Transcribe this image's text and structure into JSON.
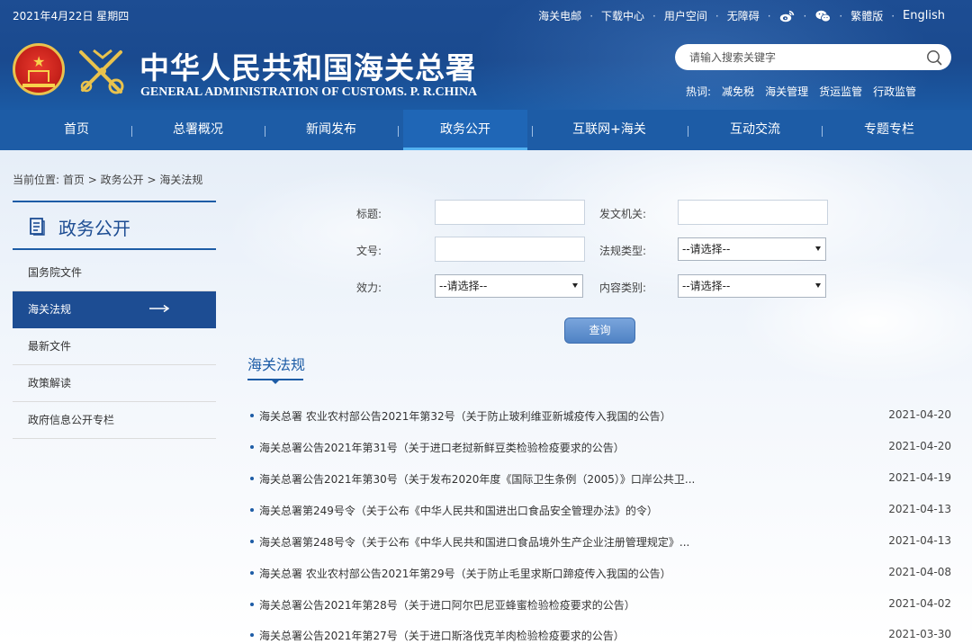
{
  "header": {
    "date": "2021年4月22日 星期四",
    "top_links": [
      "海关电邮",
      "下载中心",
      "用户空间",
      "无障碍"
    ],
    "icons": [
      "weibo-icon",
      "wechat-icon"
    ],
    "lang_links": [
      "繁體版",
      "English"
    ],
    "title_cn": "中华人民共和国海关总署",
    "title_en": "GENERAL ADMINISTRATION OF CUSTOMS. P. R.CHINA",
    "search_placeholder": "请输入搜索关键字",
    "hot_label": "热词:",
    "hot_words": [
      "减免税",
      "海关管理",
      "货运监管",
      "行政监管"
    ]
  },
  "nav": [
    "首页",
    "总署概况",
    "新闻发布",
    "政务公开",
    "互联网+海关",
    "互动交流",
    "专题专栏"
  ],
  "nav_active": "政务公开",
  "breadcrumb": {
    "prefix": "当前位置:",
    "items": [
      "首页",
      "政务公开",
      "海关法规"
    ],
    "separator": ">"
  },
  "sidebar": {
    "title": "政务公开",
    "items": [
      "国务院文件",
      "海关法规",
      "最新文件",
      "政策解读",
      "政府信息公开专栏"
    ],
    "active": "海关法规"
  },
  "form": {
    "title_label": "标题:",
    "issuer_label": "发文机关:",
    "docno_label": "文号:",
    "type_label": "法规类型:",
    "type_value": "--请选择--",
    "effect_label": "效力:",
    "effect_value": "--请选择--",
    "category_label": "内容类别:",
    "category_value": "--请选择--",
    "query_button": "查询"
  },
  "section_title": "海关法规",
  "news": [
    {
      "title": "海关总署 农业农村部公告2021年第32号（关于防止玻利维亚新城疫传入我国的公告）",
      "date": "2021-04-20"
    },
    {
      "title": "海关总署公告2021年第31号（关于进口老挝新鲜豆类检验检疫要求的公告）",
      "date": "2021-04-20"
    },
    {
      "title": "海关总署公告2021年第30号（关于发布2020年度《国际卫生条例（2005）》口岸公共卫...",
      "date": "2021-04-19"
    },
    {
      "title": "海关总署第249号令（关于公布《中华人民共和国进出口食品安全管理办法》的令）",
      "date": "2021-04-13"
    },
    {
      "title": "海关总署第248号令（关于公布《中华人民共和国进口食品境外生产企业注册管理规定》...",
      "date": "2021-04-13"
    },
    {
      "title": "海关总署 农业农村部公告2021年第29号（关于防止毛里求斯口蹄疫传入我国的公告）",
      "date": "2021-04-08"
    },
    {
      "title": "海关总署公告2021年第28号（关于进口阿尔巴尼亚蜂蜜检验检疫要求的公告）",
      "date": "2021-04-02"
    },
    {
      "title": "海关总署公告2021年第27号（关于进口斯洛伐克羊肉检验检疫要求的公告）",
      "date": "2021-03-30"
    }
  ],
  "colors": {
    "header_blue": "#1d4d93",
    "nav_blue": "#1d5ca6",
    "active_underline": "#53b1f0"
  }
}
